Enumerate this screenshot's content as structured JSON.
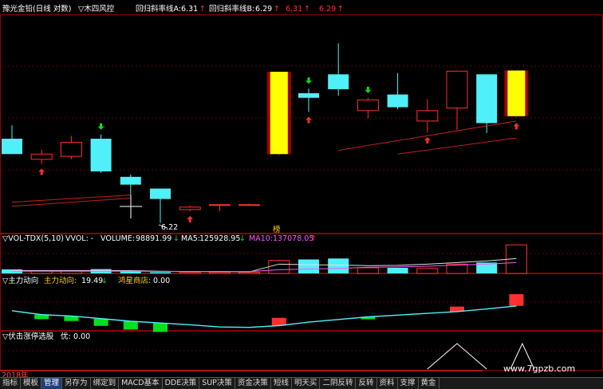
{
  "header": {
    "title": "豫光金铅(日线 对数)",
    "indicator": "▽木四风控",
    "line_a_label": "回归斜率线A:",
    "line_a_value": "6.31",
    "line_b_label": "回归斜率线B:",
    "line_b_value": "6.29",
    "extra_1": "6.31",
    "extra_2": "6.29",
    "arrow": "↑"
  },
  "annotations": {
    "low_price": "6.22",
    "mark_top": "榜"
  },
  "vol_panel": {
    "name": "▽VOL-TDX(5,10)",
    "vvol": "VVOL: -",
    "volume_label": "VOLUME:",
    "volume_value": "98891.99",
    "ma5_label": "MA5:",
    "ma5_value": "125928.95",
    "ma10_label": "MA10:",
    "ma10_value": "137078.05",
    "down": "↓",
    "up": "↑"
  },
  "main_force_panel": {
    "name": "▽主力动向",
    "label": "主力动向:",
    "value": "19.49",
    "down": "↓",
    "star_label": "鸿星商店:",
    "star_value": "0.00"
  },
  "limit_panel": {
    "name": "▽伏击涨停选股",
    "label": "优:",
    "value": "0.00"
  },
  "footer": {
    "year": "2018年",
    "watermark": "www.7gpzb.com",
    "tabs": [
      "指标",
      "模板",
      "管理",
      "另存为",
      "绑定到",
      "MACD基本",
      "DDE决策",
      "SUP决策",
      "资金决策",
      "短线",
      "明天买",
      "二阴反转",
      "反转",
      "资料",
      "支撑",
      "黄金"
    ],
    "active_tab": 2
  },
  "colors": {
    "up": "#ff3030",
    "down": "#50f0f8",
    "yellow": "#ffff00",
    "dark_red": "#a00000",
    "green": "#00e020",
    "magenta": "#ff55ff",
    "grid": "#8b0000"
  },
  "chart_data": {
    "type": "candlestick",
    "price_scale": "log",
    "candles": [
      {
        "o": 7.33,
        "h": 7.52,
        "l": 7.16,
        "c": 7.12
      },
      {
        "o": 7.05,
        "h": 7.18,
        "l": 6.99,
        "c": 7.12
      },
      {
        "o": 7.09,
        "h": 7.37,
        "l": 7.05,
        "c": 7.28
      },
      {
        "o": 7.33,
        "h": 7.39,
        "l": 6.87,
        "c": 6.89
      },
      {
        "o": 6.82,
        "h": 6.85,
        "l": 6.6,
        "c": 6.72
      },
      {
        "o": 6.67,
        "h": 6.67,
        "l": 6.25,
        "c": 6.54
      },
      {
        "o": 6.41,
        "h": 6.46,
        "l": 6.39,
        "c": 6.44
      },
      {
        "o": 6.46,
        "h": 6.46,
        "l": 6.39,
        "c": 6.47
      },
      {
        "o": 6.47,
        "h": 6.48,
        "l": 6.47,
        "c": 6.47
      },
      {
        "o": 7.12,
        "h": 8.3,
        "l": 7.1,
        "c": 8.32
      },
      {
        "o": 7.99,
        "h": 8.06,
        "l": 7.71,
        "c": 7.92
      },
      {
        "o": 8.28,
        "h": 8.78,
        "l": 7.95,
        "c": 8.05
      },
      {
        "o": 7.73,
        "h": 7.92,
        "l": 7.62,
        "c": 7.89
      },
      {
        "o": 7.97,
        "h": 8.3,
        "l": 7.75,
        "c": 7.78
      },
      {
        "o": 7.58,
        "h": 7.9,
        "l": 7.42,
        "c": 7.73
      },
      {
        "o": 7.77,
        "h": 8.34,
        "l": 7.45,
        "c": 8.33
      },
      {
        "o": 8.28,
        "h": 8.28,
        "l": 7.41,
        "c": 7.55
      },
      {
        "o": 7.65,
        "h": 8.34,
        "l": 7.62,
        "c": 8.34
      }
    ],
    "special_yellow": [
      9,
      17
    ],
    "trend_lines": [
      {
        "name": "回归斜率线A",
        "from": [
          0,
          6.5
        ],
        "to": [
          4,
          6.59
        ]
      },
      {
        "name": "回归斜率线B",
        "from": [
          0,
          6.45
        ],
        "to": [
          4,
          6.55
        ]
      },
      {
        "name": "upper",
        "from": [
          11,
          7.17
        ],
        "to": [
          17,
          7.58
        ]
      },
      {
        "name": "lower",
        "from": [
          13,
          7.12
        ],
        "to": [
          17,
          7.34
        ]
      }
    ],
    "arrows": [
      {
        "i": 1,
        "dir": "up",
        "color": "red"
      },
      {
        "i": 3,
        "dir": "down",
        "color": "green"
      },
      {
        "i": 6,
        "dir": "up",
        "color": "red"
      },
      {
        "i": 10,
        "dir": "down",
        "color": "green"
      },
      {
        "i": 10,
        "dir": "up",
        "color": "red"
      },
      {
        "i": 12,
        "dir": "down",
        "color": "green"
      },
      {
        "i": 14,
        "dir": "up",
        "color": "red"
      },
      {
        "i": 17,
        "dir": "up",
        "color": "red"
      }
    ],
    "volume": [
      13000,
      8000,
      8000,
      14000,
      8000,
      4000,
      4000,
      4000,
      4000,
      42000,
      45000,
      48000,
      18000,
      18000,
      16000,
      30000,
      35000,
      92000
    ],
    "ma5": [
      9000,
      9000,
      9000,
      9000,
      9000,
      7000,
      6000,
      6000,
      5000,
      30000,
      28000,
      27000,
      25000,
      26000,
      30000,
      35000,
      40000,
      48000
    ],
    "ma10": [
      7000,
      7000,
      7000,
      7000,
      7000,
      6500,
      6000,
      6000,
      6000,
      12000,
      14000,
      16000,
      20000,
      21000,
      23000,
      27000,
      30000,
      35000
    ],
    "main_force_line": [
      4,
      -5,
      -8,
      -14,
      -20,
      -24,
      -28,
      -33,
      -34,
      -30,
      -22,
      -16,
      -10,
      -6,
      -2,
      2,
      8,
      15
    ],
    "main_force_bars": [
      0,
      -16,
      -18,
      -26,
      -30,
      -32,
      0,
      0,
      0,
      28,
      0,
      0,
      -6,
      0,
      0,
      18,
      0,
      42
    ],
    "limit_signals": [
      {
        "start": 14.0,
        "peak": 15.0,
        "end": 16.0
      },
      {
        "start": 16.8,
        "peak": 17.2,
        "end": 17.6
      }
    ]
  }
}
